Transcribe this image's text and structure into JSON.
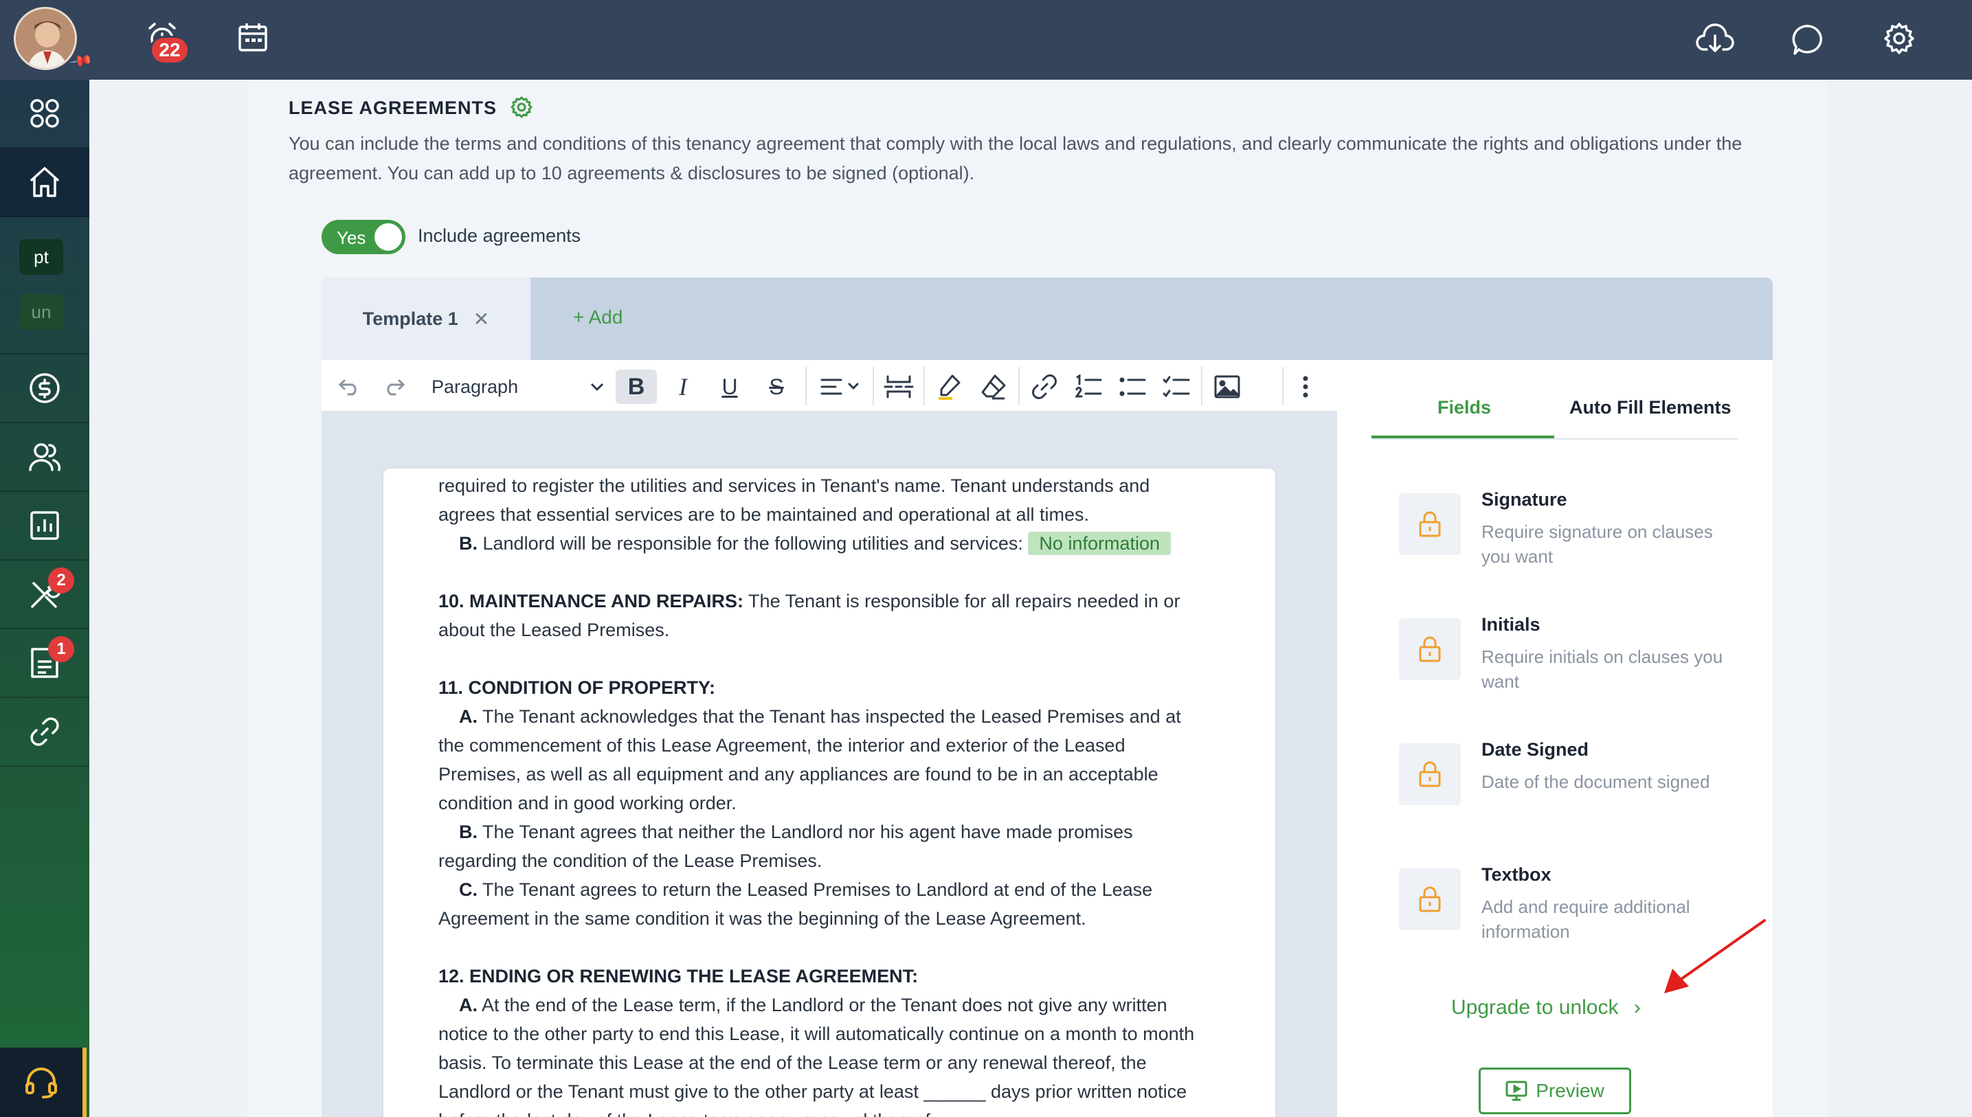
{
  "topbar": {
    "notifications_count": "22"
  },
  "sidebar": {
    "chip_pt": "pt",
    "chip_un": "un",
    "tools_badge": "2",
    "docs_badge": "1"
  },
  "section": {
    "title": "LEASE AGREEMENTS",
    "description": "You can include the terms and conditions of this tenancy agreement that comply with the local laws and regulations, and clearly communicate the rights and obligations under the agreement. You can add up to 10 agreements & disclosures to be signed (optional)."
  },
  "toggle": {
    "state_label": "Yes",
    "label": "Include agreements"
  },
  "tabs": {
    "active_label": "Template 1",
    "add_label": "+ Add"
  },
  "toolbar": {
    "block_format": "Paragraph"
  },
  "document": {
    "line1": "required to register the utilities and services in Tenant's name. Tenant understands and",
    "line2": "agrees that essential services are to be maintained and operational at all times.",
    "b_label": "B.",
    "b_text": " Landlord will be responsible for the following utilities and services: ",
    "no_info": "No information",
    "s10_title": "10. MAINTENANCE AND REPAIRS:",
    "s10_text": " The Tenant is responsible for all repairs needed in or",
    "s10_line2": "about the Leased Premises.",
    "s11_title": "11. CONDITION OF PROPERTY:",
    "s11_a_label": "A.",
    "s11_a_l1": " The Tenant acknowledges that the Tenant has inspected the Leased Premises and at",
    "s11_a_l2": "the commencement of this Lease Agreement, the interior and exterior of the Leased",
    "s11_a_l3": "Premises, as well as all equipment and any appliances are found to be in an acceptable",
    "s11_a_l4": "condition and in good working order.",
    "s11_b_label": "B.",
    "s11_b_l1": " The Tenant agrees that neither the Landlord nor his agent have made promises",
    "s11_b_l2": "regarding the condition of the Lease Premises.",
    "s11_c_label": "C.",
    "s11_c_l1": " The Tenant agrees to return the Leased Premises to Landlord at end of the Lease",
    "s11_c_l2": "Agreement in the same condition it was the beginning of the Lease Agreement.",
    "s12_title": "12. ENDING OR RENEWING THE LEASE AGREEMENT:",
    "s12_a_label": "A.",
    "s12_a_l1": " At the end of the Lease term, if the Landlord or the Tenant does not give any written",
    "s12_a_l2": "notice to the other party to end this Lease, it will automatically continue on a month to month",
    "s12_a_l3": "basis. To terminate this Lease at the end of the Lease term or any renewal thereof, the",
    "s12_a_l4": "Landlord or the Tenant must give to the other party at least ______ days prior written notice",
    "s12_a_l5": "before the last day of the Lease term or any renewal thereof."
  },
  "panel": {
    "tab_fields": "Fields",
    "tab_autofill": "Auto Fill Elements",
    "fields": [
      {
        "name": "Signature",
        "desc": "Require signature on clauses you want"
      },
      {
        "name": "Initials",
        "desc": "Require initials on clauses you want"
      },
      {
        "name": "Date Signed",
        "desc": "Date of the document signed"
      },
      {
        "name": "Textbox",
        "desc": "Add and require additional information"
      }
    ],
    "upgrade_label": "Upgrade to unlock",
    "upgrade_chevron": "›",
    "preview_label": "Preview"
  },
  "colors": {
    "accent": "#3f9a45",
    "topbar": "#34445a",
    "badge": "#e23b3b",
    "lock": "#f0a030"
  }
}
